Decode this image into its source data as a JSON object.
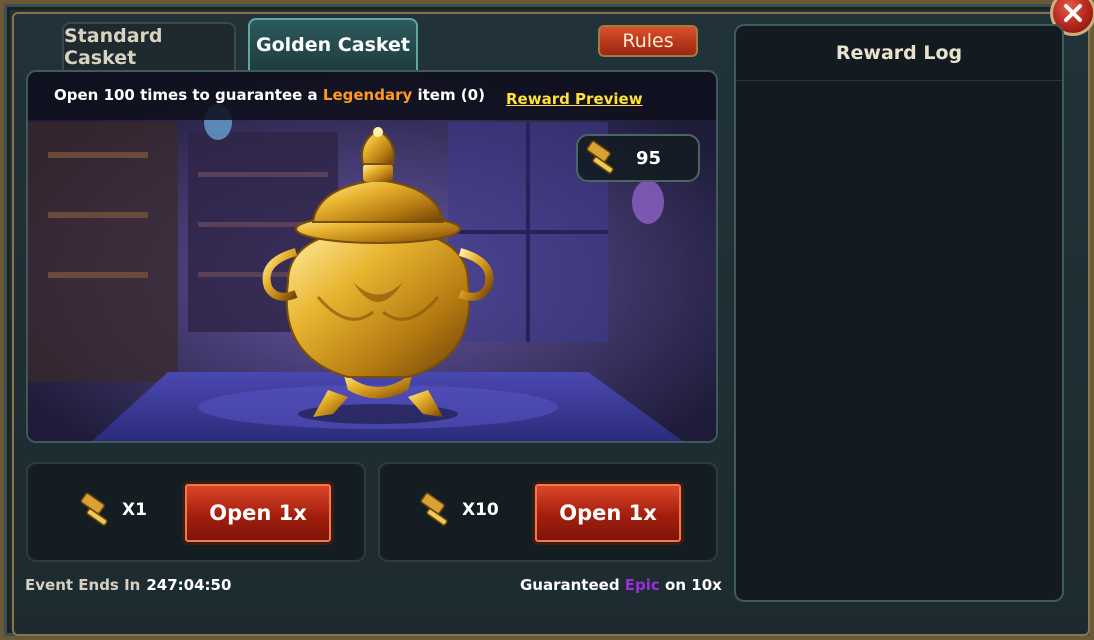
{
  "tabs": [
    {
      "label": "Standard Casket",
      "active": false
    },
    {
      "label": "Golden Casket",
      "active": true
    }
  ],
  "rules_label": "Rules",
  "banner": {
    "prefix": "Open 100 times to guarantee a ",
    "highlight": "Legendary",
    "suffix": " item (0)",
    "highlight_color": "#ff9a1f"
  },
  "reward_preview_label": "Reward Preview",
  "hammer_balance": "95",
  "open_options": [
    {
      "cost_label": "X1",
      "button_label": "Open 1x"
    },
    {
      "cost_label": "X10",
      "button_label": "Open 1x"
    }
  ],
  "event": {
    "label": "Event Ends In",
    "time": "247:04:50"
  },
  "guarantee": {
    "prefix": "Guaranteed ",
    "highlight": "Epic",
    "suffix": " on 10x",
    "highlight_color": "#9b2fd9"
  },
  "log": {
    "title": "Reward Log"
  },
  "icons": {
    "close": "close-icon",
    "hammer": "hammer-icon",
    "casket": "golden-casket-image"
  },
  "colors": {
    "accent_gold": "#ffe13a",
    "button_red": "#a31e0e",
    "panel_teal": "#2c5a5c"
  }
}
